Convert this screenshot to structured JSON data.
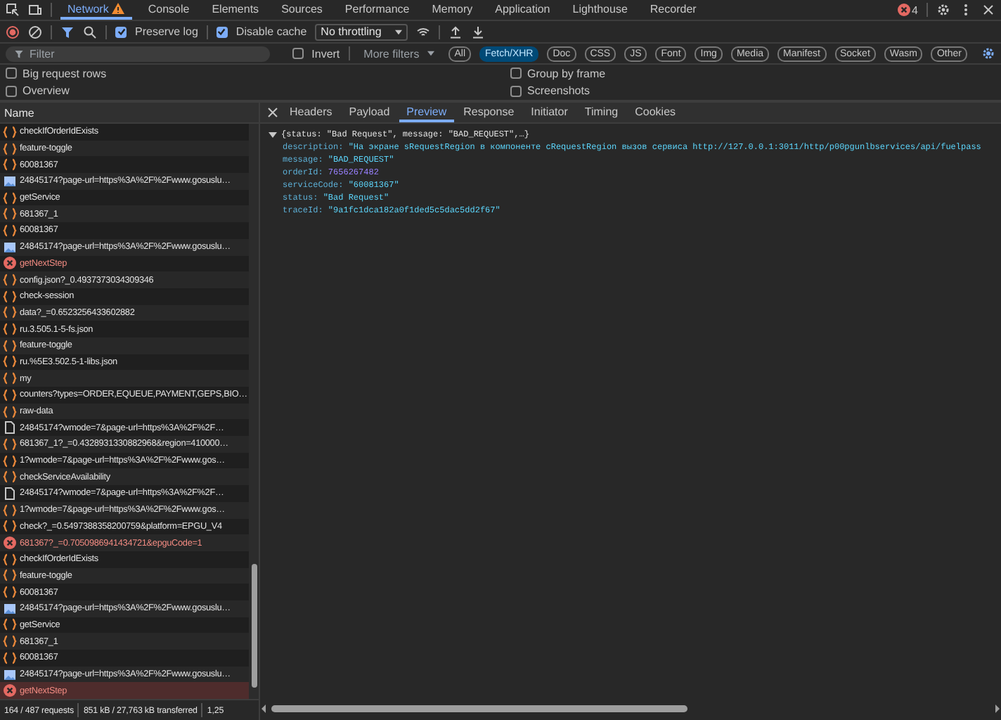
{
  "panel_tabs": [
    {
      "label": "Network",
      "selected": true,
      "warning": true
    },
    {
      "label": "Console",
      "selected": false,
      "warning": false
    },
    {
      "label": "Elements",
      "selected": false,
      "warning": false
    },
    {
      "label": "Sources",
      "selected": false,
      "warning": false
    },
    {
      "label": "Performance",
      "selected": false,
      "warning": false
    },
    {
      "label": "Memory",
      "selected": false,
      "warning": false
    },
    {
      "label": "Application",
      "selected": false,
      "warning": false
    },
    {
      "label": "Lighthouse",
      "selected": false,
      "warning": false
    },
    {
      "label": "Recorder",
      "selected": false,
      "warning": false
    }
  ],
  "error_count": "4",
  "toolbar": {
    "preserve_log": {
      "label": "Preserve log",
      "checked": true
    },
    "disable_cache": {
      "label": "Disable cache",
      "checked": true
    },
    "throttling": "No throttling"
  },
  "filter": {
    "placeholder": "Filter",
    "invert": {
      "label": "Invert",
      "checked": false
    },
    "more_filters": "More filters",
    "types": [
      {
        "label": "All",
        "selected": false
      },
      {
        "label": "Fetch/XHR",
        "selected": true
      },
      {
        "label": "Doc",
        "selected": false
      },
      {
        "label": "CSS",
        "selected": false
      },
      {
        "label": "JS",
        "selected": false
      },
      {
        "label": "Font",
        "selected": false
      },
      {
        "label": "Img",
        "selected": false
      },
      {
        "label": "Media",
        "selected": false
      },
      {
        "label": "Manifest",
        "selected": false
      },
      {
        "label": "Socket",
        "selected": false
      },
      {
        "label": "Wasm",
        "selected": false
      },
      {
        "label": "Other",
        "selected": false
      }
    ]
  },
  "options": [
    {
      "label": "Big request rows",
      "checked": false
    },
    {
      "label": "Group by frame",
      "checked": false
    },
    {
      "label": "Overview",
      "checked": false
    },
    {
      "label": "Screenshots",
      "checked": false
    }
  ],
  "requests": {
    "column": "Name",
    "rows": [
      {
        "name": "checkIfOrderIdExists",
        "kind": "xhr",
        "selected": false
      },
      {
        "name": "feature-toggle",
        "kind": "xhr",
        "selected": false
      },
      {
        "name": "60081367",
        "kind": "xhr",
        "selected": false
      },
      {
        "name": "24845174?page-url=https%3A%2F%2Fwww.gosuslu…",
        "kind": "img",
        "selected": false
      },
      {
        "name": "getService",
        "kind": "xhr",
        "selected": false
      },
      {
        "name": "681367_1",
        "kind": "xhr",
        "selected": false
      },
      {
        "name": "60081367",
        "kind": "xhr",
        "selected": false
      },
      {
        "name": "24845174?page-url=https%3A%2F%2Fwww.gosuslu…",
        "kind": "img",
        "selected": false
      },
      {
        "name": "getNextStep",
        "kind": "error",
        "selected": false
      },
      {
        "name": "config.json?_0.4937373034309346",
        "kind": "xhr",
        "selected": false
      },
      {
        "name": "check-session",
        "kind": "xhr",
        "selected": false
      },
      {
        "name": "data?_=0.6523256433602882",
        "kind": "xhr",
        "selected": false
      },
      {
        "name": "ru.3.505.1-5-fs.json",
        "kind": "xhr",
        "selected": false
      },
      {
        "name": "feature-toggle",
        "kind": "xhr",
        "selected": false
      },
      {
        "name": "ru.%5E3.502.5-1-libs.json",
        "kind": "xhr",
        "selected": false
      },
      {
        "name": "my",
        "kind": "xhr",
        "selected": false
      },
      {
        "name": "counters?types=ORDER,EQUEUE,PAYMENT,GEPS,BIO…",
        "kind": "xhr",
        "selected": false
      },
      {
        "name": "raw-data",
        "kind": "xhr",
        "selected": false
      },
      {
        "name": "24845174?wmode=7&page-url=https%3A%2F%2F…",
        "kind": "doc",
        "selected": false
      },
      {
        "name": "681367_1?_=0.4328931330882968&region=410000…",
        "kind": "xhr",
        "selected": false
      },
      {
        "name": "1?wmode=7&page-url=https%3A%2F%2Fwww.gos…",
        "kind": "xhr",
        "selected": false
      },
      {
        "name": "checkServiceAvailability",
        "kind": "xhr",
        "selected": false
      },
      {
        "name": "24845174?wmode=7&page-url=https%3A%2F%2F…",
        "kind": "doc",
        "selected": false
      },
      {
        "name": "1?wmode=7&page-url=https%3A%2F%2Fwww.gos…",
        "kind": "xhr",
        "selected": false
      },
      {
        "name": "check?_=0.5497388358200759&platform=EPGU_V4",
        "kind": "xhr",
        "selected": false
      },
      {
        "name": "681367?_=0.7050986941434721&epguCode=1",
        "kind": "error",
        "selected": false
      },
      {
        "name": "checkIfOrderIdExists",
        "kind": "xhr",
        "selected": false
      },
      {
        "name": "feature-toggle",
        "kind": "xhr",
        "selected": false
      },
      {
        "name": "60081367",
        "kind": "xhr",
        "selected": false
      },
      {
        "name": "24845174?page-url=https%3A%2F%2Fwww.gosuslu…",
        "kind": "img",
        "selected": false
      },
      {
        "name": "getService",
        "kind": "xhr",
        "selected": false
      },
      {
        "name": "681367_1",
        "kind": "xhr",
        "selected": false
      },
      {
        "name": "60081367",
        "kind": "xhr",
        "selected": false
      },
      {
        "name": "24845174?page-url=https%3A%2F%2Fwww.gosuslu…",
        "kind": "img",
        "selected": false
      },
      {
        "name": "getNextStep",
        "kind": "error",
        "selected": true
      }
    ]
  },
  "status_bar": [
    "164 / 487 requests",
    "851 kB / 27,763 kB transferred",
    "1,25"
  ],
  "detail_tabs": [
    {
      "label": "Headers",
      "selected": false
    },
    {
      "label": "Payload",
      "selected": false
    },
    {
      "label": "Preview",
      "selected": true
    },
    {
      "label": "Response",
      "selected": false
    },
    {
      "label": "Initiator",
      "selected": false
    },
    {
      "label": "Timing",
      "selected": false
    },
    {
      "label": "Cookies",
      "selected": false
    }
  ],
  "preview": {
    "summary": "{status: \"Bad Request\", message: \"BAD_REQUEST\",…}",
    "expanded": true,
    "properties": [
      {
        "key": "description:",
        "value": "\"На экране sRequestRegion в компоненте cRequestRegion вызов сервиса http://127.0.0.1:3011/http/p00pgunlbservices/api/fuelpass",
        "kind": "string"
      },
      {
        "key": "message:",
        "value": "\"BAD_REQUEST\"",
        "kind": "string"
      },
      {
        "key": "orderId:",
        "value": "7656267482",
        "kind": "number"
      },
      {
        "key": "serviceCode:",
        "value": "\"60081367\"",
        "kind": "string"
      },
      {
        "key": "status:",
        "value": "\"Bad Request\"",
        "kind": "string"
      },
      {
        "key": "traceId:",
        "value": "\"9a1fc1dca182a0f1ded5c5dac5dd2f67\"",
        "kind": "string"
      }
    ]
  }
}
